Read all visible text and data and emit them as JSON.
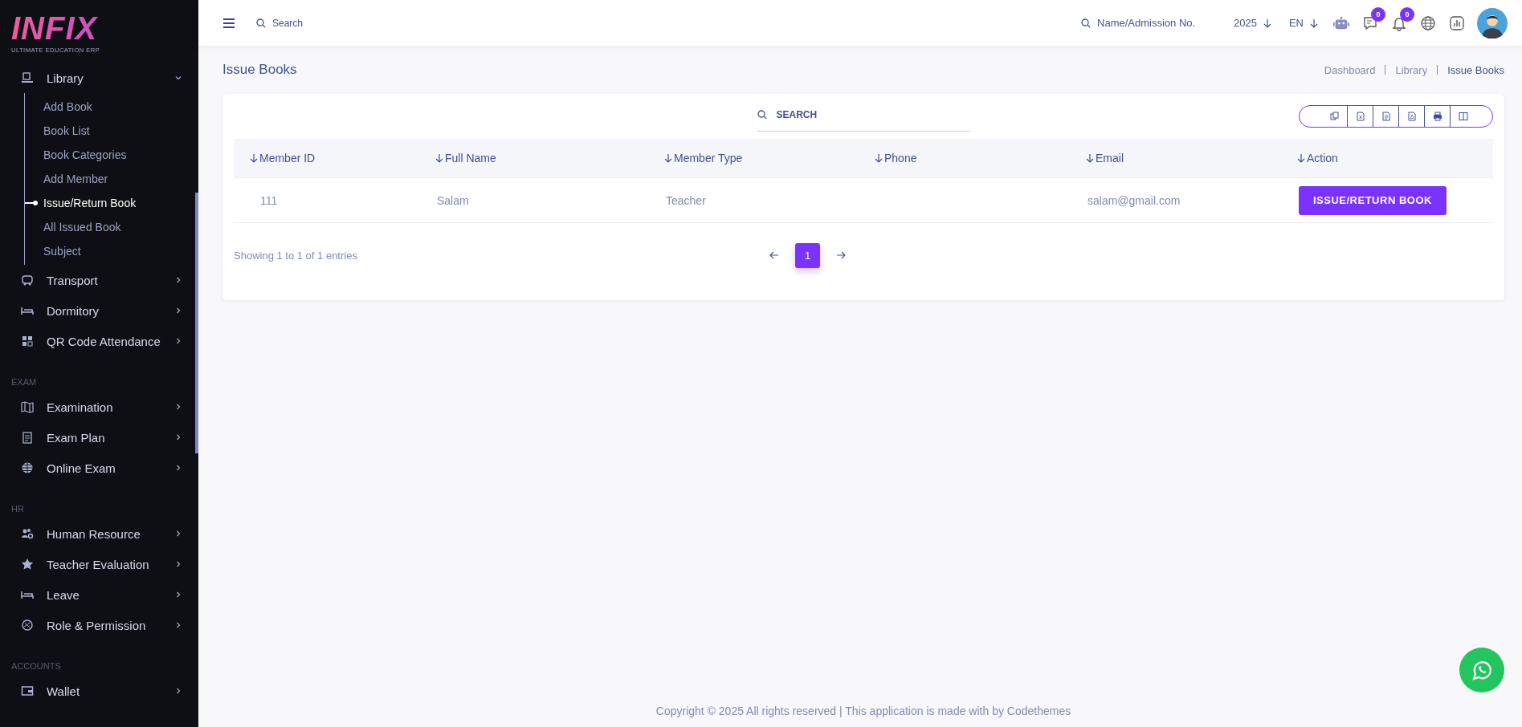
{
  "sidebar": {
    "logo": {
      "title": "INFIX",
      "subtitle": "ULTIMATE EDUCATION ERP"
    },
    "sections": [
      {
        "items": [
          {
            "label": "Library",
            "expanded": true,
            "children": [
              {
                "label": "Add Book",
                "selected": false
              },
              {
                "label": "Book List",
                "selected": false
              },
              {
                "label": "Book Categories",
                "selected": false
              },
              {
                "label": "Add Member",
                "selected": false
              },
              {
                "label": "Issue/Return Book",
                "selected": true
              },
              {
                "label": "All Issued Book",
                "selected": false
              },
              {
                "label": "Subject",
                "selected": false
              }
            ]
          },
          {
            "label": "Transport",
            "expanded": false
          },
          {
            "label": "Dormitory",
            "expanded": false
          },
          {
            "label": "QR Code Attendance",
            "expanded": false
          }
        ]
      },
      {
        "heading": "EXAM",
        "items": [
          {
            "label": "Examination",
            "expanded": false
          },
          {
            "label": "Exam Plan",
            "expanded": false
          },
          {
            "label": "Online Exam",
            "expanded": false
          }
        ]
      },
      {
        "heading": "HR",
        "items": [
          {
            "label": "Human Resource",
            "expanded": false
          },
          {
            "label": "Teacher Evaluation",
            "expanded": false
          },
          {
            "label": "Leave",
            "expanded": false
          },
          {
            "label": "Role & Permission",
            "expanded": false
          }
        ]
      },
      {
        "heading": "ACCOUNTS",
        "items": [
          {
            "label": "Wallet",
            "expanded": false
          }
        ]
      }
    ]
  },
  "header": {
    "search": {
      "placeholder": "Search"
    },
    "student_search": {
      "placeholder": "Name/Admission No."
    },
    "year": "2025",
    "language": "EN",
    "chat_badge": "0",
    "notification_badge": "0"
  },
  "page": {
    "title": "Issue Books",
    "breadcrumb": [
      "Dashboard",
      "Library",
      "Issue Books"
    ]
  },
  "table": {
    "search": {
      "placeholder": "SEARCH"
    },
    "columns": [
      "Member ID",
      "Full Name",
      "Member Type",
      "Phone",
      "Email",
      "Action"
    ],
    "rows": [
      {
        "member_id": "111",
        "full_name": "Salam",
        "member_type": "Teacher",
        "email": "salam@gmail.com",
        "action": "ISSUE/RETURN BOOK"
      }
    ],
    "info": "Showing 1 to 1 of 1 entries",
    "pages": [
      {
        "label": "1",
        "selected": true
      }
    ]
  },
  "footer": "Copyright © 2025 All rights reserved | This application is made with by Codethemes"
}
